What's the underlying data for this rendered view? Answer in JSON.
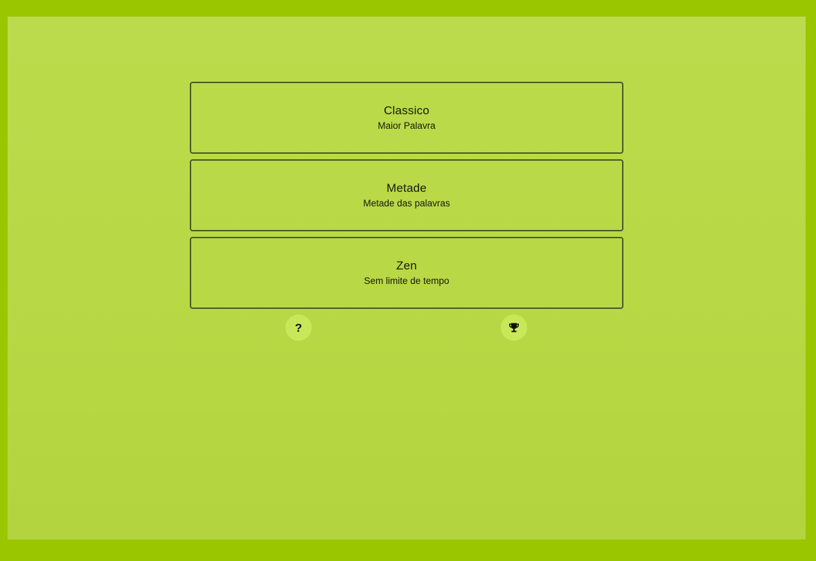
{
  "modes": [
    {
      "title": "Classico",
      "subtitle": "Maior Palavra"
    },
    {
      "title": "Metade",
      "subtitle": "Metade das palavras"
    },
    {
      "title": "Zen",
      "subtitle": "Sem limite de tempo"
    }
  ],
  "actions": {
    "help_label": "?",
    "help_icon": "question-mark-icon",
    "leaderboard_icon": "trophy-icon"
  },
  "colors": {
    "outer_background": "#9ac600",
    "panel_background": "#b8d845",
    "button_background": "#c8e85a",
    "card_border": "#4a5a22",
    "text": "#161a0a"
  }
}
